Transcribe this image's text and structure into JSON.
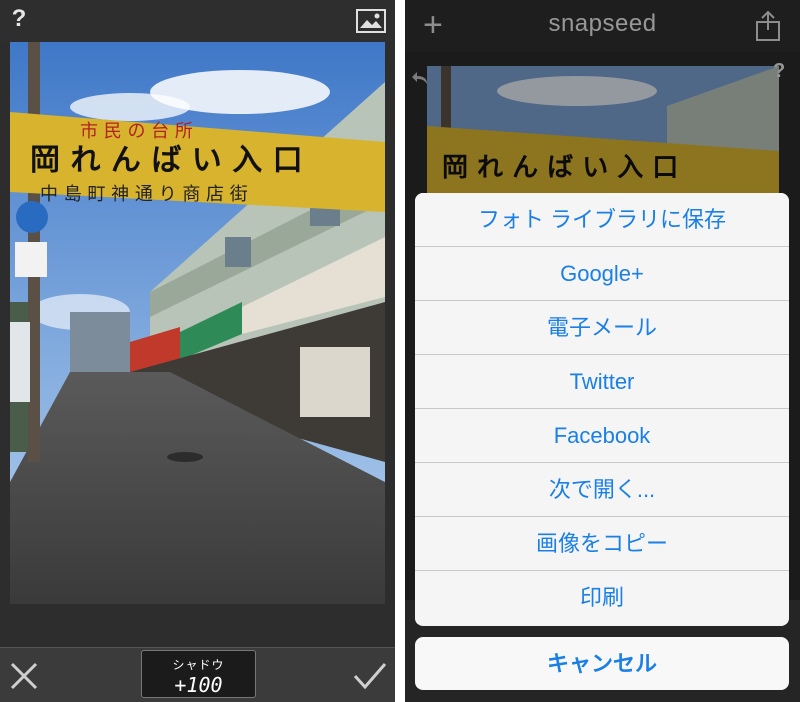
{
  "editor": {
    "help_icon": "question-mark",
    "image_icon": "image-icon",
    "parameter_name": "シャドウ",
    "parameter_value": "+100",
    "cancel_icon": "close-icon",
    "confirm_icon": "checkmark-icon"
  },
  "share_screen": {
    "app_title": "snapseed",
    "add_icon": "plus-icon",
    "share_icon": "share-icon",
    "help_icon": "question-mark",
    "menu_items": [
      {
        "label": "フォト ライブラリに保存"
      },
      {
        "label": "Google+"
      },
      {
        "label": "電子メール"
      },
      {
        "label": "Twitter"
      },
      {
        "label": "Facebook"
      },
      {
        "label": "次で開く..."
      },
      {
        "label": "画像をコピー"
      },
      {
        "label": "印刷"
      }
    ],
    "cancel_label": "キャンセル",
    "accent_color": "#1a7fe6"
  },
  "photo": {
    "banner_text_top": "市 民 の 台 所",
    "banner_text_main": "岡 れ ん ば い 入 口",
    "banner_text_sub": "中 島 町 神 通 り 商 店 街"
  }
}
